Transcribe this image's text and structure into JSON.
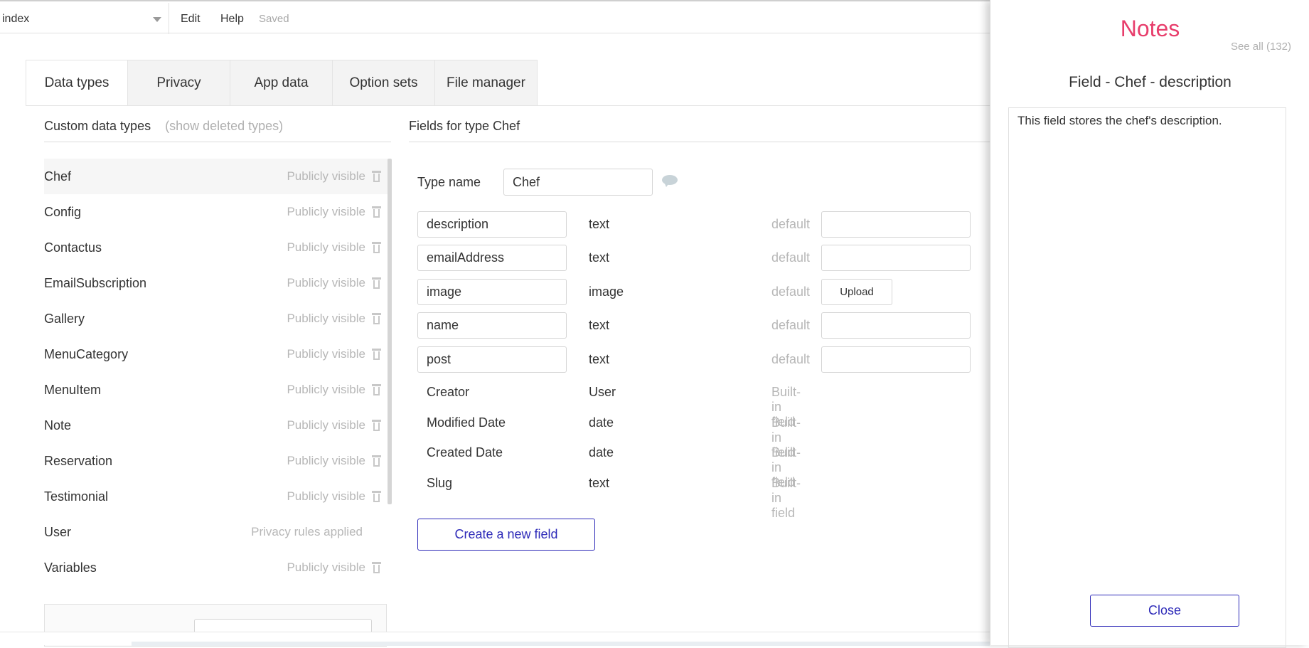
{
  "topbar": {
    "page_select": "index",
    "menu": [
      "Edit",
      "Help"
    ],
    "status": "Saved"
  },
  "tabs": [
    "Data types",
    "Privacy",
    "App data",
    "Option sets",
    "File manager"
  ],
  "active_tab": "Data types",
  "left": {
    "title": "Custom data types",
    "show_deleted": "(show deleted types)",
    "types": [
      {
        "name": "Chef",
        "visibility": "Publicly visible",
        "selected": true
      },
      {
        "name": "Config",
        "visibility": "Publicly visible"
      },
      {
        "name": "Contactus",
        "visibility": "Publicly visible"
      },
      {
        "name": "EmailSubscription",
        "visibility": "Publicly visible"
      },
      {
        "name": "Gallery",
        "visibility": "Publicly visible"
      },
      {
        "name": "MenuCategory",
        "visibility": "Publicly visible"
      },
      {
        "name": "MenuItem",
        "visibility": "Publicly visible"
      },
      {
        "name": "Note",
        "visibility": "Publicly visible"
      },
      {
        "name": "Reservation",
        "visibility": "Publicly visible"
      },
      {
        "name": "Testimonial",
        "visibility": "Publicly visible"
      },
      {
        "name": "User",
        "visibility": "Privacy rules applied"
      },
      {
        "name": "Variables",
        "visibility": "Publicly visible"
      }
    ]
  },
  "right": {
    "title": "Fields for type Chef",
    "type_name_label": "Type name",
    "type_name_value": "Chef",
    "fields": [
      {
        "name": "description",
        "type": "text",
        "default": "default"
      },
      {
        "name": "emailAddress",
        "type": "text",
        "default": "default"
      },
      {
        "name": "image",
        "type": "image",
        "default": "default",
        "upload": "Upload"
      },
      {
        "name": "name",
        "type": "text",
        "default": "default"
      },
      {
        "name": "post",
        "type": "text",
        "default": "default"
      }
    ],
    "builtin": [
      {
        "name": "Creator",
        "type": "User",
        "note": "Built-in field"
      },
      {
        "name": "Modified Date",
        "type": "date",
        "note": "Built-in field"
      },
      {
        "name": "Created Date",
        "type": "date",
        "note": "Built-in field"
      },
      {
        "name": "Slug",
        "type": "text",
        "note": "Built-in field"
      }
    ],
    "create_button": "Create a new field"
  },
  "notes": {
    "title": "Notes",
    "see_all": "See all (132)",
    "heading": "Field - Chef - description",
    "text": "This field stores the chef's description.",
    "close": "Close",
    "title_color": "#e83e6c"
  }
}
